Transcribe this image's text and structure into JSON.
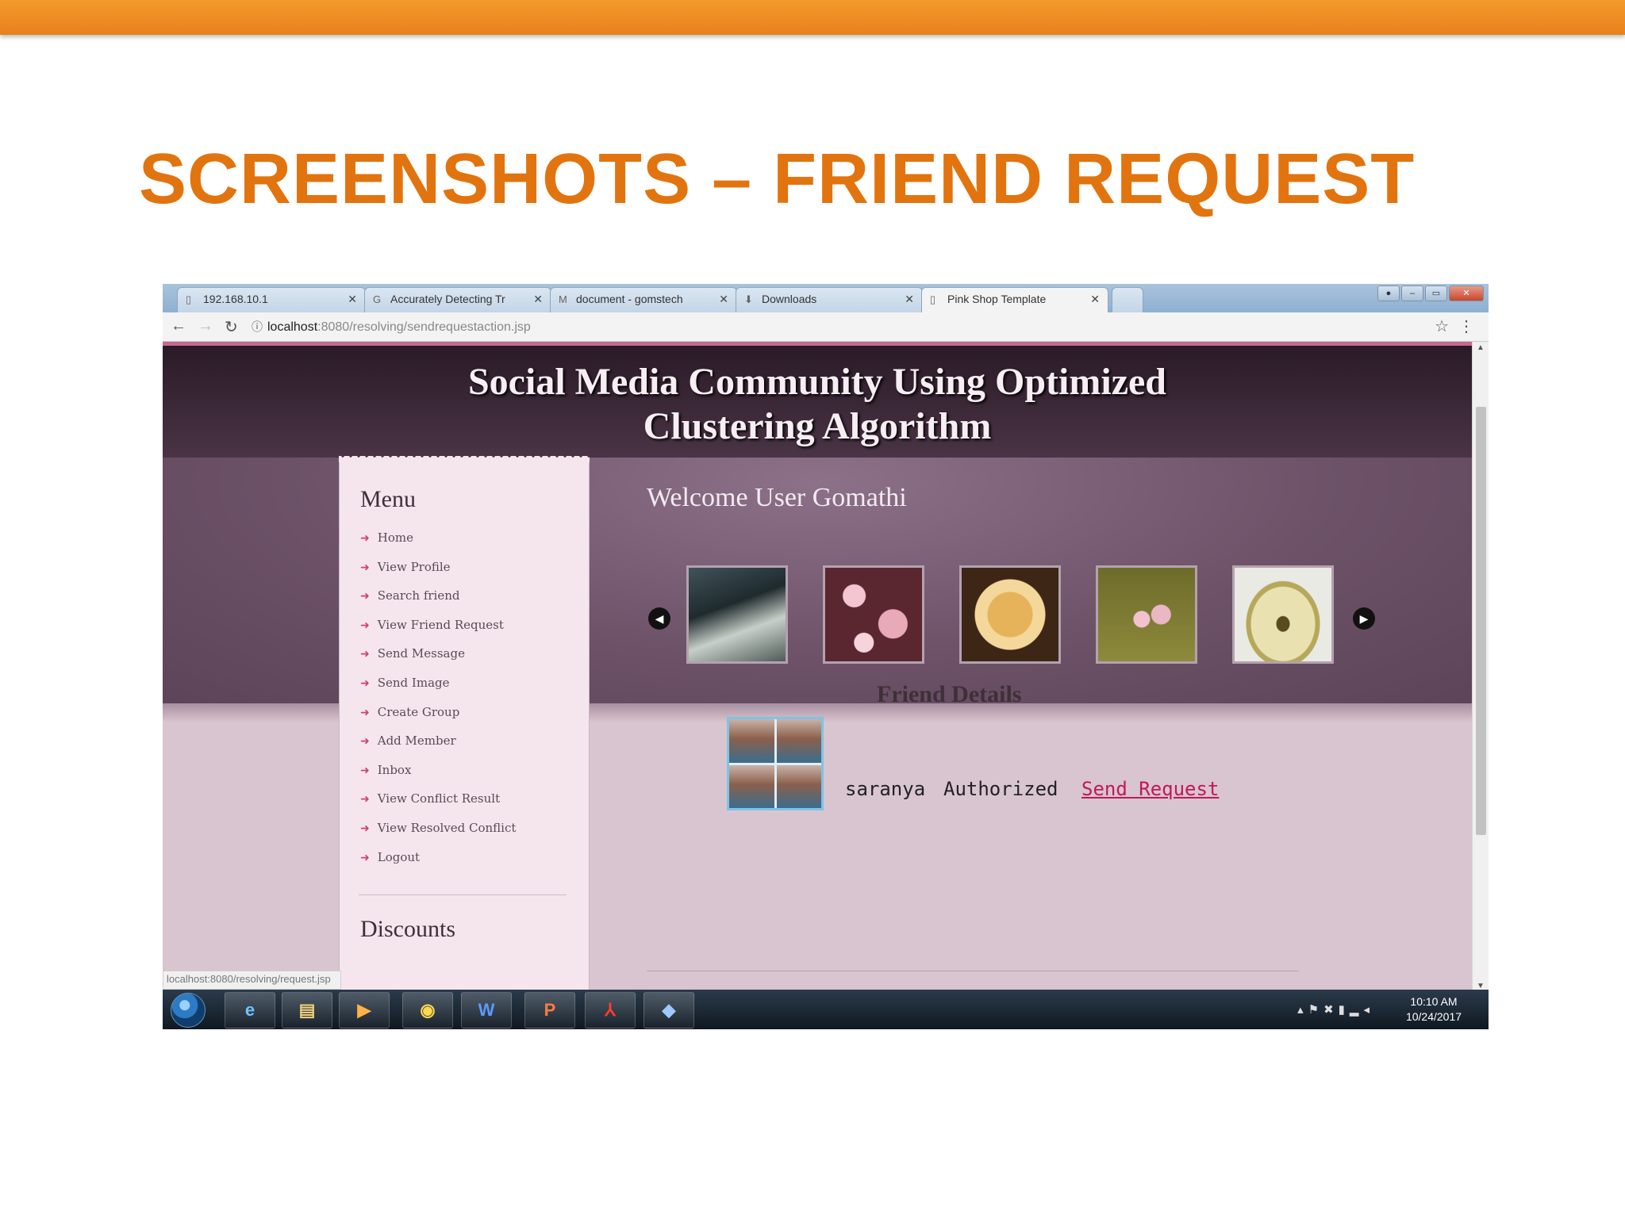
{
  "slide": {
    "title": "SCREENSHOTS – FRIEND REQUEST"
  },
  "browser": {
    "tabs": [
      {
        "label": "192.168.10.1",
        "icon": "page-icon"
      },
      {
        "label": "Accurately Detecting Tr",
        "icon": "google-icon"
      },
      {
        "label": "document - gomstech",
        "icon": "gmail-icon"
      },
      {
        "label": "Downloads",
        "icon": "download-icon"
      },
      {
        "label": "Pink Shop Template",
        "icon": "page-icon"
      }
    ],
    "url_host": "localhost",
    "url_path": ":8080/resolving/sendrequestaction.jsp",
    "status_url": "localhost:8080/resolving/request.jsp"
  },
  "site": {
    "title_line1": "Social Media Community Using Optimized",
    "title_line2": "Clustering Algorithm",
    "welcome": "Welcome User  Gomathi"
  },
  "sidebar": {
    "menu_title": "Menu",
    "items": [
      "Home",
      "View Profile",
      "Search friend",
      "View Friend Request",
      "Send Message",
      "Send Image",
      "Create Group",
      "Add Member",
      "Inbox",
      "View Conflict Result",
      "View Resolved Conflict",
      "Logout"
    ],
    "discounts_title": "Discounts"
  },
  "friend": {
    "section_title": "Friend Details",
    "name": "saranya",
    "status": "Authorized",
    "action": "Send Request"
  },
  "taskbar": {
    "clock_time": "10:10 AM",
    "clock_date": "10/24/2017",
    "apps": [
      "start",
      "internet-explorer",
      "file-explorer",
      "media-player",
      "chrome",
      "word",
      "powerpoint",
      "acrobat",
      "virtualbox"
    ]
  },
  "colors": {
    "accent": "#e2740f",
    "header": "#2a1a27",
    "link": "#c2185b"
  }
}
